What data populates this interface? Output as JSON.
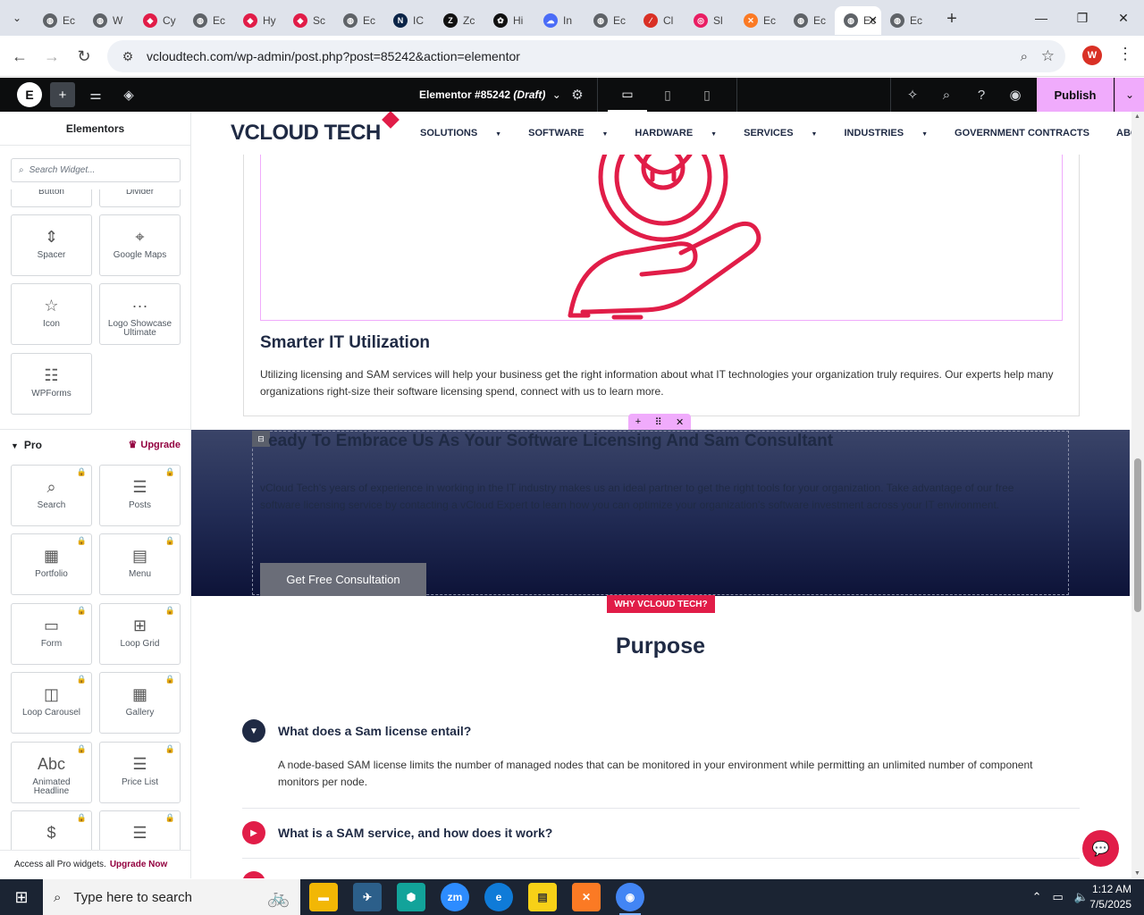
{
  "browser": {
    "tabs": [
      {
        "label": "Ec",
        "icon": "globe-icon",
        "color": "#5f6368"
      },
      {
        "label": "W",
        "icon": "globe-icon",
        "color": "#5f6368"
      },
      {
        "label": "Cy",
        "icon": "diamond-icon",
        "color": "#e11d48"
      },
      {
        "label": "Ec",
        "icon": "globe-icon",
        "color": "#5f6368"
      },
      {
        "label": "Hy",
        "icon": "diamond-icon",
        "color": "#e11d48"
      },
      {
        "label": "Sc",
        "icon": "diamond-icon",
        "color": "#e11d48"
      },
      {
        "label": "Ec",
        "icon": "globe-icon",
        "color": "#5f6368"
      },
      {
        "label": "IC",
        "icon": "n-logo-icon",
        "color": "#0b2447"
      },
      {
        "label": "Zc",
        "icon": "z-logo-icon",
        "color": "#111111"
      },
      {
        "label": "Hi",
        "icon": "openai-icon",
        "color": "#111111"
      },
      {
        "label": "In",
        "icon": "cloud-icon",
        "color": "#4a6cf7"
      },
      {
        "label": "Ec",
        "icon": "globe-icon",
        "color": "#5f6368"
      },
      {
        "label": "Cl",
        "icon": "slash-icon",
        "color": "#d93025"
      },
      {
        "label": "Sl",
        "icon": "ring-icon",
        "color": "#e91e63"
      },
      {
        "label": "Ec",
        "icon": "xampp-icon",
        "color": "#fb7a24"
      },
      {
        "label": "Ec",
        "icon": "globe-icon",
        "color": "#5f6368"
      },
      {
        "label": "Ec",
        "icon": "globe-icon",
        "color": "#5f6368",
        "active": true
      },
      {
        "label": "Ec",
        "icon": "globe-icon",
        "color": "#5f6368"
      }
    ],
    "url": "vcloudtech.com/wp-admin/post.php?post=85242&action=elementor",
    "profile_initial": "W"
  },
  "editor": {
    "doc_title": "Elementor #85242",
    "doc_status": "(Draft)",
    "publish_label": "Publish"
  },
  "panel": {
    "title": "Elementors",
    "search_placeholder": "Search Widget...",
    "partial_labels": [
      "Button",
      "Divider"
    ],
    "basic_widgets": [
      {
        "label": "Spacer",
        "icon": "spacer-icon",
        "glyph": "⇕"
      },
      {
        "label": "Google Maps",
        "icon": "map-icon",
        "glyph": "⌖"
      },
      {
        "label": "Icon",
        "icon": "star-icon",
        "glyph": "☆"
      },
      {
        "label": "Logo Showcase Ultimate",
        "icon": "logo-showcase-icon",
        "glyph": "···"
      },
      {
        "label": "WPForms",
        "icon": "wpforms-icon",
        "glyph": "☷"
      }
    ],
    "pro_title": "Pro",
    "upgrade_label": "Upgrade",
    "pro_widgets": [
      {
        "label": "Search",
        "icon": "search-widget-icon",
        "glyph": "⌕"
      },
      {
        "label": "Posts",
        "icon": "posts-icon",
        "glyph": "☰"
      },
      {
        "label": "Portfolio",
        "icon": "portfolio-icon",
        "glyph": "▦"
      },
      {
        "label": "Menu",
        "icon": "menu-icon",
        "glyph": "▤"
      },
      {
        "label": "Form",
        "icon": "form-icon",
        "glyph": "▭"
      },
      {
        "label": "Loop Grid",
        "icon": "loop-grid-icon",
        "glyph": "⊞"
      },
      {
        "label": "Loop Carousel",
        "icon": "loop-carousel-icon",
        "glyph": "◫"
      },
      {
        "label": "Gallery",
        "icon": "gallery-icon",
        "glyph": "▦"
      },
      {
        "label": "Animated Headline",
        "icon": "animated-headline-icon",
        "glyph": "Abc"
      },
      {
        "label": "Price List",
        "icon": "price-list-icon",
        "glyph": "☰"
      },
      {
        "label": "",
        "icon": "price-table-icon",
        "glyph": "$"
      },
      {
        "label": "",
        "icon": "flip-box-icon",
        "glyph": "☰"
      }
    ],
    "footer_text": "Access all Pro widgets.",
    "footer_link": "Upgrade Now"
  },
  "site": {
    "logo_text": "VCLOUD TECH",
    "nav": [
      {
        "label": "SOLUTIONS",
        "dropdown": true
      },
      {
        "label": "SOFTWARE",
        "dropdown": true
      },
      {
        "label": "HARDWARE",
        "dropdown": true
      },
      {
        "label": "SERVICES",
        "dropdown": true
      },
      {
        "label": "INDUSTRIES",
        "dropdown": true
      },
      {
        "label": "GOVERNMENT CONTRACTS",
        "dropdown": false
      },
      {
        "label": "ABOUT US",
        "dropdown": false
      }
    ],
    "card": {
      "title": "Smarter IT Utilization",
      "text": "Utilizing licensing and SAM services will help your business get the right information about what IT technologies your organization truly requires. Our experts help many organizations right-size their software licensing spend, connect with us to learn more."
    },
    "cta": {
      "title": "eady To Embrace Us As Your Software Licensing And Sam Consultant",
      "text": "vCloud Tech's years of experience in working in the IT industry makes us an ideal partner to get the right tools for your organization. Take advantage of our free software licensing service by contacting a vCloud Expert to learn how you can optimize your organization's software investment across your IT environment.",
      "button": "Get Free Consultation"
    },
    "why_badge": "WHY VCLOUD TECH?",
    "purpose_heading": "Purpose",
    "faq": [
      {
        "question": "What does a Sam license entail?",
        "answer": "A node-based SAM license limits the number of managed nodes that can be monitored in your environment while permitting an unlimited number of component monitors per node.",
        "open": true
      },
      {
        "question": "What is a SAM service, and how does it work?",
        "answer": "",
        "open": false
      }
    ],
    "accent_color": "#e11d48",
    "navy_color": "#1f2a44"
  },
  "taskbar": {
    "search_placeholder": "Type here to search",
    "time": "1:12 AM",
    "date": "7/5/2025"
  }
}
